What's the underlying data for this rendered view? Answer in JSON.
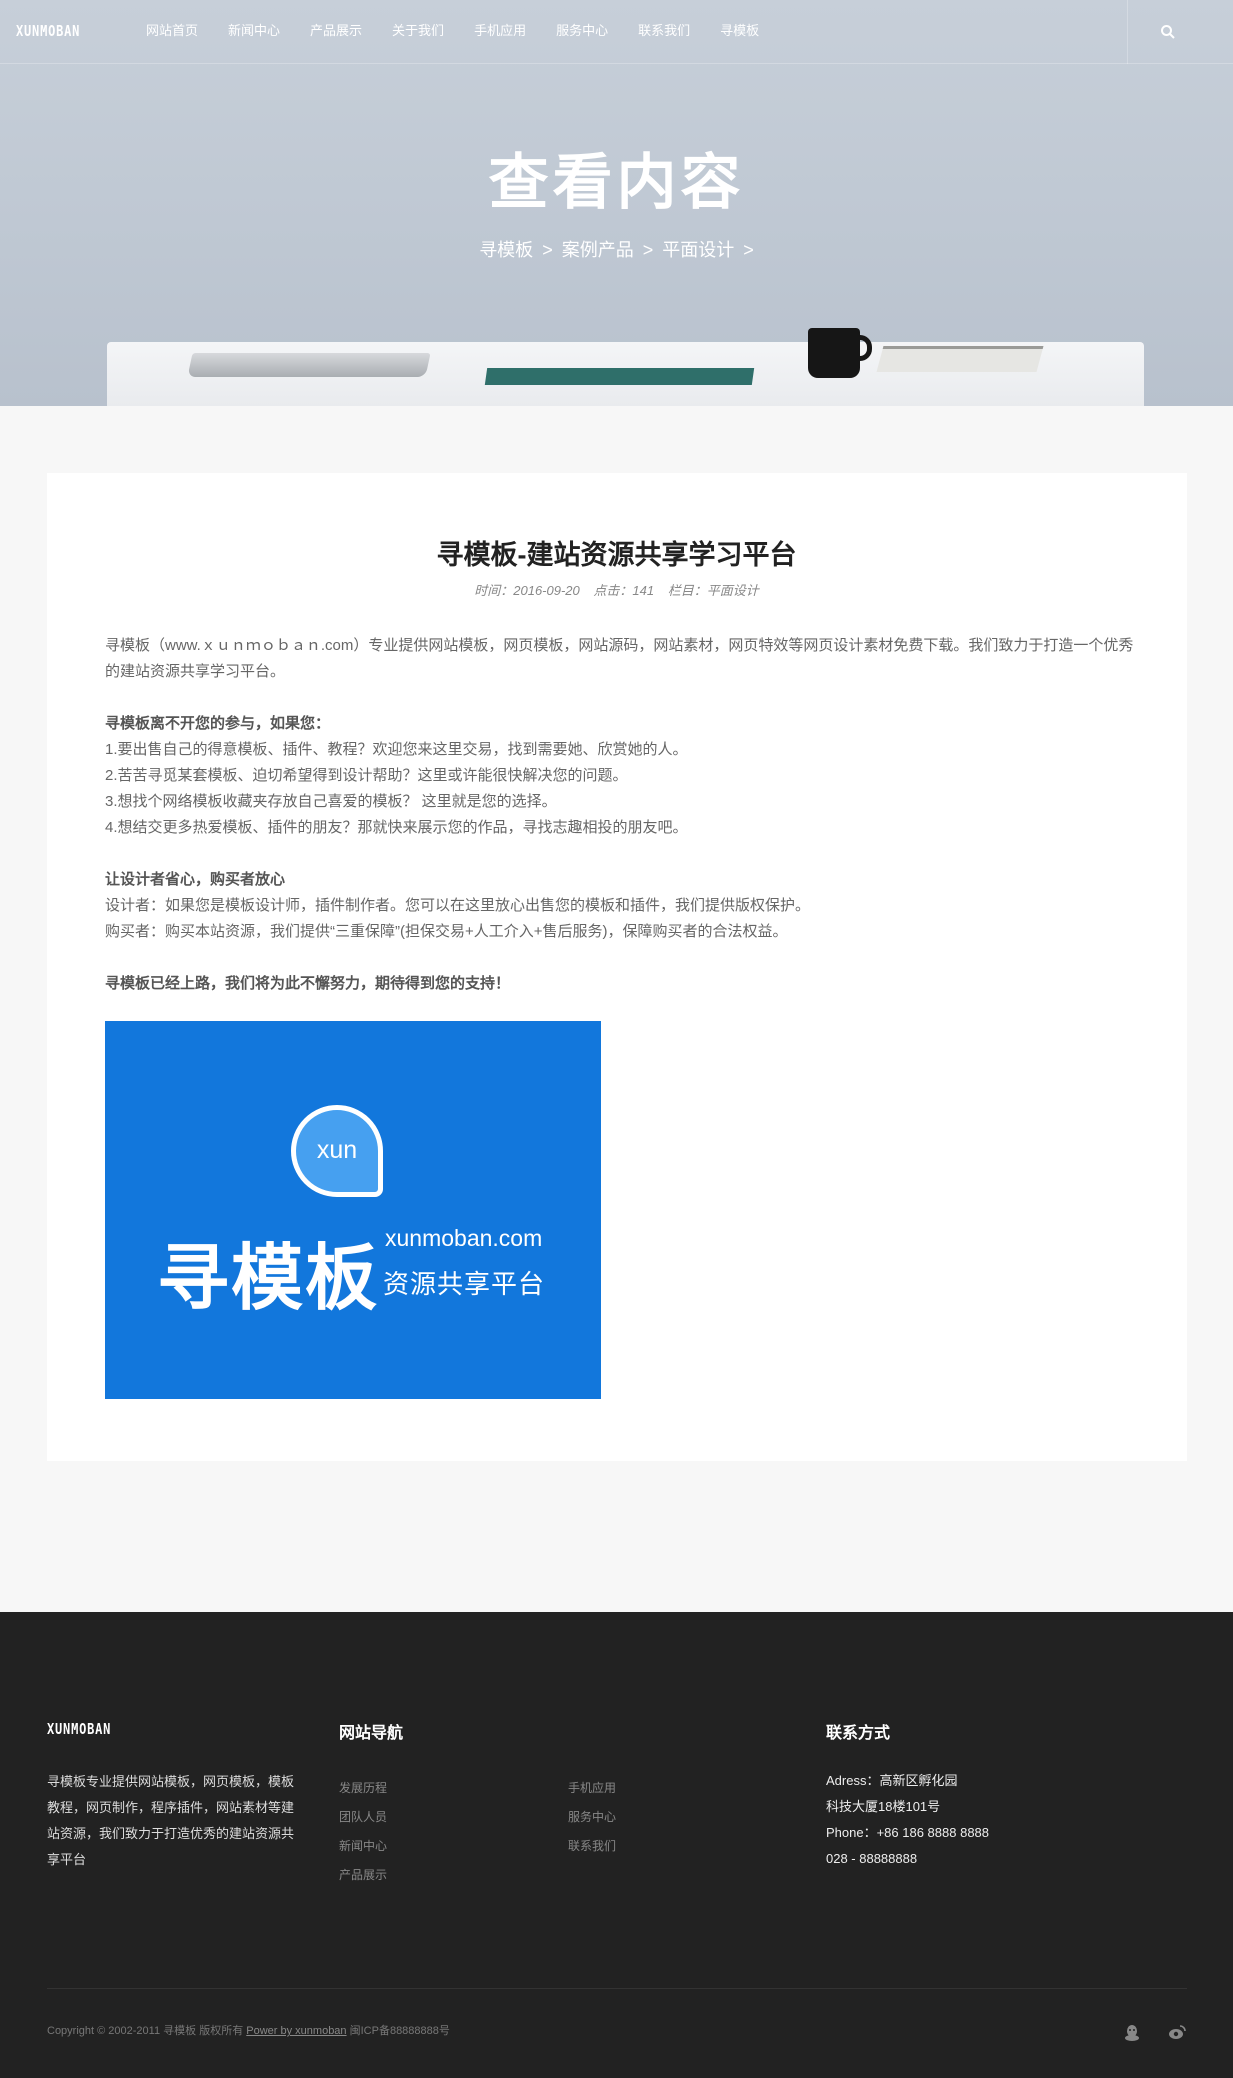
{
  "nav": {
    "logo": "XUNMOBAN",
    "items": [
      "网站首页",
      "新闻中心",
      "产品展示",
      "关于我们",
      "手机应用",
      "服务中心",
      "联系我们",
      "寻模板"
    ]
  },
  "hero": {
    "title": "查看内容",
    "breadcrumb": [
      "寻模板",
      ">",
      "案例产品",
      ">",
      "平面设计",
      ">"
    ]
  },
  "article": {
    "title": "寻模板-建站资源共享学习平台",
    "meta": {
      "time": "时间：2016-09-20",
      "clicks": "点击：141",
      "column": "栏目：平面设计"
    },
    "intro": "寻模板（www.ｘｕｎｍｏｂａｎ.com）专业提供网站模板，网页模板，网站源码，网站素材，网页特效等网页设计素材免费下载。我们致力于打造一个优秀的建站资源共享学习平台。",
    "section1_head": "寻模板离不开您的参与，如果您：",
    "section1_items": [
      "1.要出售自己的得意模板、插件、教程？欢迎您来这里交易，找到需要她、欣赏她的人。",
      "2.苦苦寻觅某套模板、迫切希望得到设计帮助？这里或许能很快解决您的问题。",
      "3.想找个网络模板收藏夹存放自己喜爱的模板？ 这里就是您的选择。",
      "4.想结交更多热爱模板、插件的朋友？那就快来展示您的作品，寻找志趣相投的朋友吧。"
    ],
    "section2_head": "让设计者省心，购买者放心",
    "section2_items": [
      "设计者：如果您是模板设计师，插件制作者。您可以在这里放心出售您的模板和插件，我们提供版权保护。",
      "购买者：购买本站资源，我们提供“三重保障”(担保交易+人工介入+售后服务)，保障购买者的合法权益。"
    ],
    "closing": "寻模板已经上路，我们将为此不懈努力，期待得到您的支持！",
    "image": {
      "bubble": "xun",
      "big": "寻模板",
      "url": "xunmoban.com",
      "sub": "资源共享平台"
    }
  },
  "footer": {
    "logo": "XUNMOBAN",
    "about": "寻模板专业提供网站模板，网页模板，模板教程，网页制作，程序插件，网站素材等建站资源，我们致力于打造优秀的建站资源共享平台",
    "nav_title": "网站导航",
    "nav_col1": [
      "发展历程",
      "团队人员",
      "新闻中心",
      "产品展示"
    ],
    "nav_col2": [
      "手机应用",
      "服务中心",
      "联系我们"
    ],
    "contact_title": "联系方式",
    "contact": [
      "Adress：高新区孵化园",
      "科技大厦18楼101号",
      "Phone：+86 186 8888 8888",
      "028 - 88888888"
    ],
    "copyright_pre": "Copyright © 2002-2011 寻模板 版权所有",
    "copyright_link": "Power by xunmoban",
    "copyright_post": "闽ICP备88888888号"
  },
  "colors": {
    "promo_blue": "#1277dc",
    "footer_bg": "#222222"
  }
}
